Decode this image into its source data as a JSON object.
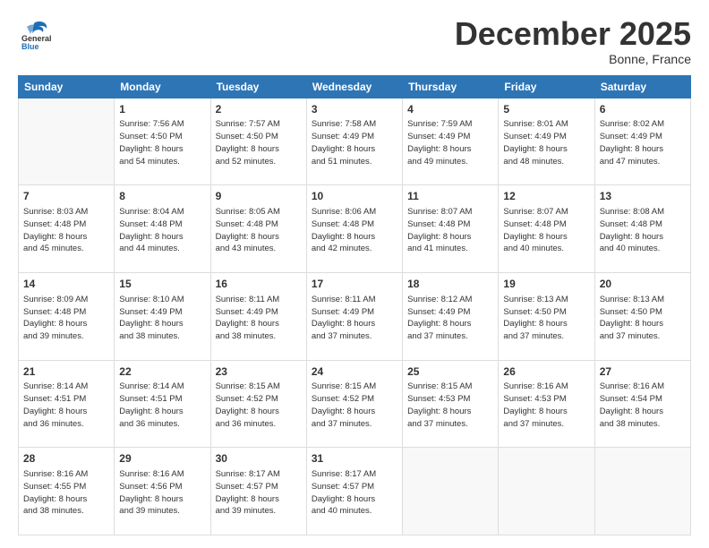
{
  "header": {
    "logo_general": "General",
    "logo_blue": "Blue",
    "month": "December 2025",
    "location": "Bonne, France"
  },
  "weekdays": [
    "Sunday",
    "Monday",
    "Tuesday",
    "Wednesday",
    "Thursday",
    "Friday",
    "Saturday"
  ],
  "weeks": [
    [
      {
        "day": "",
        "info": ""
      },
      {
        "day": "1",
        "info": "Sunrise: 7:56 AM\nSunset: 4:50 PM\nDaylight: 8 hours\nand 54 minutes."
      },
      {
        "day": "2",
        "info": "Sunrise: 7:57 AM\nSunset: 4:50 PM\nDaylight: 8 hours\nand 52 minutes."
      },
      {
        "day": "3",
        "info": "Sunrise: 7:58 AM\nSunset: 4:49 PM\nDaylight: 8 hours\nand 51 minutes."
      },
      {
        "day": "4",
        "info": "Sunrise: 7:59 AM\nSunset: 4:49 PM\nDaylight: 8 hours\nand 49 minutes."
      },
      {
        "day": "5",
        "info": "Sunrise: 8:01 AM\nSunset: 4:49 PM\nDaylight: 8 hours\nand 48 minutes."
      },
      {
        "day": "6",
        "info": "Sunrise: 8:02 AM\nSunset: 4:49 PM\nDaylight: 8 hours\nand 47 minutes."
      }
    ],
    [
      {
        "day": "7",
        "info": "Sunrise: 8:03 AM\nSunset: 4:48 PM\nDaylight: 8 hours\nand 45 minutes."
      },
      {
        "day": "8",
        "info": "Sunrise: 8:04 AM\nSunset: 4:48 PM\nDaylight: 8 hours\nand 44 minutes."
      },
      {
        "day": "9",
        "info": "Sunrise: 8:05 AM\nSunset: 4:48 PM\nDaylight: 8 hours\nand 43 minutes."
      },
      {
        "day": "10",
        "info": "Sunrise: 8:06 AM\nSunset: 4:48 PM\nDaylight: 8 hours\nand 42 minutes."
      },
      {
        "day": "11",
        "info": "Sunrise: 8:07 AM\nSunset: 4:48 PM\nDaylight: 8 hours\nand 41 minutes."
      },
      {
        "day": "12",
        "info": "Sunrise: 8:07 AM\nSunset: 4:48 PM\nDaylight: 8 hours\nand 40 minutes."
      },
      {
        "day": "13",
        "info": "Sunrise: 8:08 AM\nSunset: 4:48 PM\nDaylight: 8 hours\nand 40 minutes."
      }
    ],
    [
      {
        "day": "14",
        "info": "Sunrise: 8:09 AM\nSunset: 4:48 PM\nDaylight: 8 hours\nand 39 minutes."
      },
      {
        "day": "15",
        "info": "Sunrise: 8:10 AM\nSunset: 4:49 PM\nDaylight: 8 hours\nand 38 minutes."
      },
      {
        "day": "16",
        "info": "Sunrise: 8:11 AM\nSunset: 4:49 PM\nDaylight: 8 hours\nand 38 minutes."
      },
      {
        "day": "17",
        "info": "Sunrise: 8:11 AM\nSunset: 4:49 PM\nDaylight: 8 hours\nand 37 minutes."
      },
      {
        "day": "18",
        "info": "Sunrise: 8:12 AM\nSunset: 4:49 PM\nDaylight: 8 hours\nand 37 minutes."
      },
      {
        "day": "19",
        "info": "Sunrise: 8:13 AM\nSunset: 4:50 PM\nDaylight: 8 hours\nand 37 minutes."
      },
      {
        "day": "20",
        "info": "Sunrise: 8:13 AM\nSunset: 4:50 PM\nDaylight: 8 hours\nand 37 minutes."
      }
    ],
    [
      {
        "day": "21",
        "info": "Sunrise: 8:14 AM\nSunset: 4:51 PM\nDaylight: 8 hours\nand 36 minutes."
      },
      {
        "day": "22",
        "info": "Sunrise: 8:14 AM\nSunset: 4:51 PM\nDaylight: 8 hours\nand 36 minutes."
      },
      {
        "day": "23",
        "info": "Sunrise: 8:15 AM\nSunset: 4:52 PM\nDaylight: 8 hours\nand 36 minutes."
      },
      {
        "day": "24",
        "info": "Sunrise: 8:15 AM\nSunset: 4:52 PM\nDaylight: 8 hours\nand 37 minutes."
      },
      {
        "day": "25",
        "info": "Sunrise: 8:15 AM\nSunset: 4:53 PM\nDaylight: 8 hours\nand 37 minutes."
      },
      {
        "day": "26",
        "info": "Sunrise: 8:16 AM\nSunset: 4:53 PM\nDaylight: 8 hours\nand 37 minutes."
      },
      {
        "day": "27",
        "info": "Sunrise: 8:16 AM\nSunset: 4:54 PM\nDaylight: 8 hours\nand 38 minutes."
      }
    ],
    [
      {
        "day": "28",
        "info": "Sunrise: 8:16 AM\nSunset: 4:55 PM\nDaylight: 8 hours\nand 38 minutes."
      },
      {
        "day": "29",
        "info": "Sunrise: 8:16 AM\nSunset: 4:56 PM\nDaylight: 8 hours\nand 39 minutes."
      },
      {
        "day": "30",
        "info": "Sunrise: 8:17 AM\nSunset: 4:57 PM\nDaylight: 8 hours\nand 39 minutes."
      },
      {
        "day": "31",
        "info": "Sunrise: 8:17 AM\nSunset: 4:57 PM\nDaylight: 8 hours\nand 40 minutes."
      },
      {
        "day": "",
        "info": ""
      },
      {
        "day": "",
        "info": ""
      },
      {
        "day": "",
        "info": ""
      }
    ]
  ]
}
